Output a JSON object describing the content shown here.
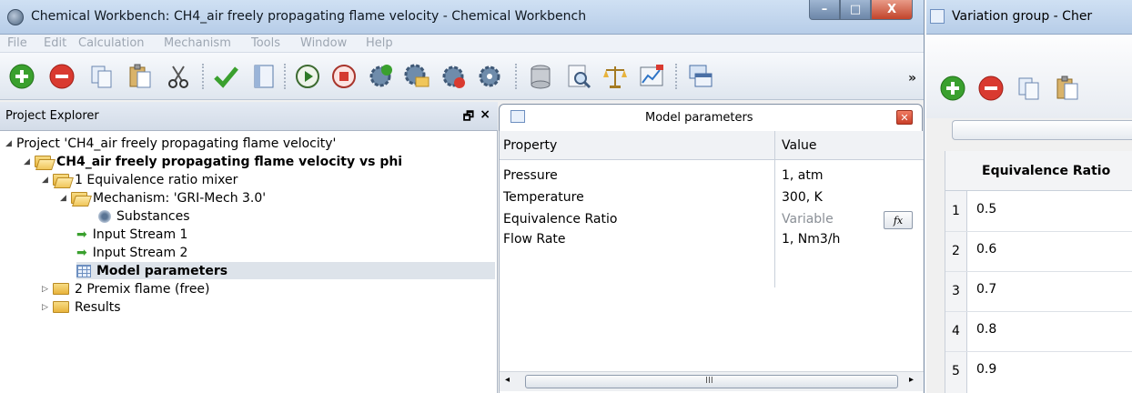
{
  "main_window": {
    "title": "Chemical Workbench: CH4_air freely propagating flame velocity - Chemical Workbench",
    "buttons": {
      "minimize": "–",
      "maximize": "□",
      "close": "X"
    }
  },
  "menu": [
    "File",
    "Edit",
    "Calculation",
    "Mechanism",
    "Tools",
    "Window",
    "Help"
  ],
  "toolbar": {
    "overflow": "»"
  },
  "explorer": {
    "title": "Project Explorer",
    "pin": "🗗",
    "close": "×",
    "tree": [
      {
        "label": "Project 'CH4_air freely propagating flame velocity'",
        "bold": false
      },
      {
        "label": "CH4_air freely propagating flame velocity vs phi",
        "bold": true
      },
      {
        "label": "1 Equivalence ratio mixer",
        "bold": false
      },
      {
        "label": "Mechanism: 'GRI-Mech 3.0'",
        "bold": false
      },
      {
        "label": "Substances",
        "bold": false
      },
      {
        "label": "Input Stream 1",
        "bold": false
      },
      {
        "label": "Input Stream 2",
        "bold": false
      },
      {
        "label": "Model parameters",
        "bold": true
      },
      {
        "label": "2 Premix flame (free)",
        "bold": false
      },
      {
        "label": "Results",
        "bold": false
      }
    ]
  },
  "model_params": {
    "tab_title": "Model parameters",
    "columns": [
      "Property",
      "Value"
    ],
    "rows": [
      {
        "property": "Pressure",
        "value": "1, atm"
      },
      {
        "property": "Temperature",
        "value": "300, K"
      },
      {
        "property": "Equivalence Ratio",
        "value": "Variable"
      },
      {
        "property": "Flow Rate",
        "value": "1, Nm3/h"
      }
    ],
    "fx_label": "fx",
    "scroll_thumb": "III"
  },
  "variation_window": {
    "title": "Variation group - Cher",
    "column": "Equivalence Ratio",
    "rows": [
      {
        "n": "1",
        "v": "0.5"
      },
      {
        "n": "2",
        "v": "0.6"
      },
      {
        "n": "3",
        "v": "0.7"
      },
      {
        "n": "4",
        "v": "0.8"
      },
      {
        "n": "5",
        "v": "0.9"
      }
    ]
  },
  "colors": {
    "accent_green": "#3aa02e",
    "accent_red": "#d93a30",
    "title_blue": "#b7cde8"
  }
}
